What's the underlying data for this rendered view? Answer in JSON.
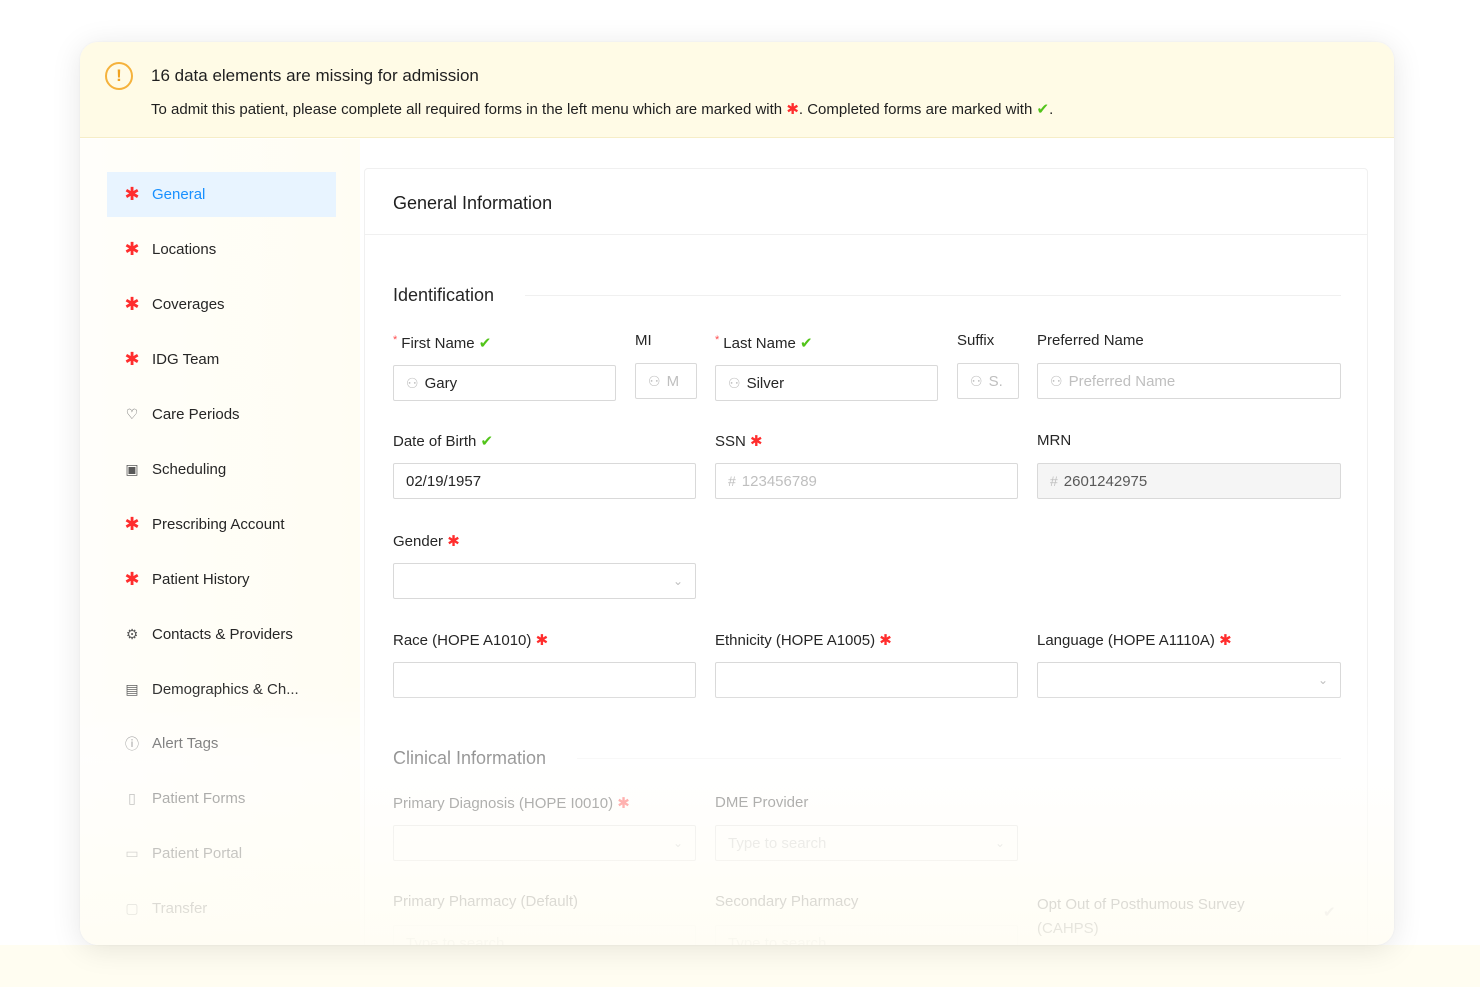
{
  "banner": {
    "title": "16 data elements are missing for admission",
    "text_before": "To admit this patient, please complete all required forms in the left menu which are marked with",
    "text_middle": ". Completed forms are marked with",
    "text_after": ".",
    "warn_symbol": "!",
    "icon": "warning-circle-icon"
  },
  "symbols": {
    "required": "✱",
    "complete": "✔",
    "person": "⚇",
    "hash": "#",
    "chevron": "⌄"
  },
  "sidebar": {
    "items": [
      {
        "label": "General",
        "icon": "required-star-icon",
        "active": true
      },
      {
        "label": "Locations",
        "icon": "required-star-icon"
      },
      {
        "label": "Coverages",
        "icon": "required-star-icon"
      },
      {
        "label": "IDG Team",
        "icon": "required-star-icon"
      },
      {
        "label": "Care Periods",
        "icon": "heart-icon",
        "glyph": "♡"
      },
      {
        "label": "Scheduling",
        "icon": "calendar-icon",
        "glyph": "▣"
      },
      {
        "label": "Prescribing Account",
        "icon": "required-star-icon"
      },
      {
        "label": "Patient History",
        "icon": "required-star-icon"
      },
      {
        "label": "Contacts & Providers",
        "icon": "gear-icon",
        "glyph": "⚙"
      },
      {
        "label": "Demographics & Ch...",
        "icon": "document-icon",
        "glyph": "▤"
      },
      {
        "label": "Alert Tags",
        "icon": "info-circle-icon",
        "glyph": "ⓘ"
      },
      {
        "label": "Patient Forms",
        "icon": "file-icon",
        "glyph": "▯"
      },
      {
        "label": "Patient Portal",
        "icon": "portal-icon",
        "glyph": "▭"
      },
      {
        "label": "Transfer",
        "icon": "transfer-icon",
        "glyph": "▢"
      }
    ]
  },
  "main": {
    "title": "General Information",
    "identification": {
      "title": "Identification",
      "first_name": {
        "label": "First Name",
        "value": "Gary"
      },
      "mi": {
        "label": "MI",
        "placeholder": "M"
      },
      "last_name": {
        "label": "Last Name",
        "value": "Silver"
      },
      "suffix": {
        "label": "Suffix",
        "placeholder": "S."
      },
      "preferred_name": {
        "label": "Preferred Name",
        "placeholder": "Preferred Name"
      },
      "dob": {
        "label": "Date of Birth",
        "value": "02/19/1957"
      },
      "ssn": {
        "label": "SSN",
        "placeholder": "123456789"
      },
      "mrn": {
        "label": "MRN",
        "value": "2601242975"
      },
      "gender": {
        "label": "Gender",
        "value": ""
      },
      "race": {
        "label": "Race (HOPE A1010)",
        "value": ""
      },
      "ethnicity": {
        "label": "Ethnicity (HOPE A1005)",
        "value": ""
      },
      "language": {
        "label": "Language (HOPE A1110A)",
        "value": ""
      }
    },
    "clinical": {
      "title": "Clinical Information",
      "primary_diagnosis": {
        "label": "Primary Diagnosis (HOPE I0010)",
        "value": ""
      },
      "dme_provider": {
        "label": "DME Provider",
        "placeholder": "Type to search"
      },
      "primary_pharmacy": {
        "label": "Primary Pharmacy (Default)",
        "placeholder": "Type to search"
      },
      "secondary_pharmacy": {
        "label": "Secondary Pharmacy",
        "placeholder": "Type to search"
      },
      "opt_out": {
        "label_line1": "Opt Out of Posthumous Survey",
        "label_line2": "(CAHPS)"
      }
    }
  },
  "colors": {
    "required": "#ff2d2d",
    "complete": "#52c41a",
    "active": "#1890ff",
    "banner_bg": "#fffbe6"
  }
}
